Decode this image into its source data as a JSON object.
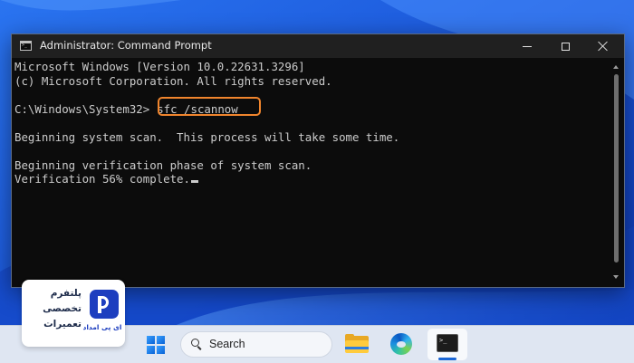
{
  "window": {
    "title": "Administrator: Command Prompt"
  },
  "console": {
    "lines": {
      "0": "Microsoft Windows [Version 10.0.22631.3296]",
      "1": "(c) Microsoft Corporation. All rights reserved.",
      "2": "C:\\Windows\\System32>",
      "3": "sfc /scannow",
      "4": "Beginning system scan.  This process will take some time.",
      "5": "Beginning verification phase of system scan.",
      "6": "Verification 56% complete."
    }
  },
  "taskbar": {
    "search_label": "Search"
  },
  "logo": {
    "line1": "پلتفرم",
    "line2": "تخصصی",
    "line3": "تعمیرات",
    "sub": "ای پی امداد"
  },
  "colors": {
    "highlight_border": "#f0852d",
    "console_bg": "#0c0c0c",
    "console_text": "#cccccc",
    "logo_blue": "#1d3ebf"
  },
  "icons": {
    "app": "command-prompt-icon",
    "start": "windows-start-icon",
    "search": "search-icon",
    "explorer": "file-explorer-icon",
    "edge": "edge-browser-icon",
    "terminal": "command-prompt-taskbar-icon"
  }
}
